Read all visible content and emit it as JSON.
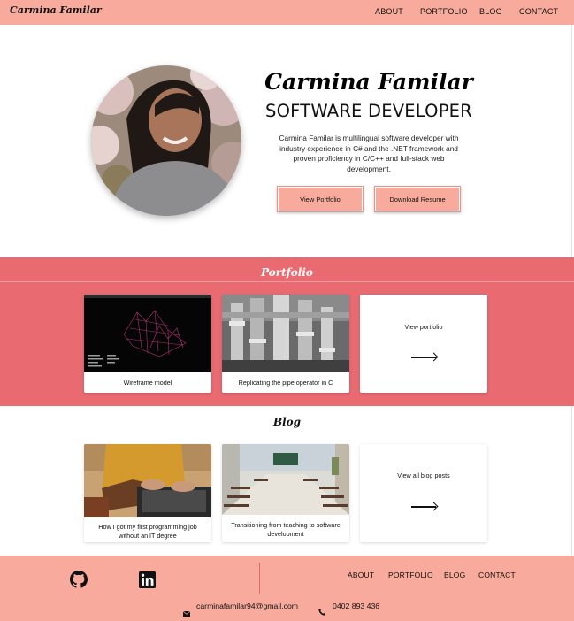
{
  "header": {
    "brand": "Carmina Familar",
    "nav": [
      "ABOUT",
      "PORTFOLIO",
      "BLOG",
      "CONTACT"
    ]
  },
  "hero": {
    "name": "Carmina Familar",
    "title": "SOFTWARE DEVELOPER",
    "description": "Carmina Familar is multilingual software developer with industry experience in C# and the .NET framework and proven proficiency in C/C++ and full-stack web development.",
    "buttons": {
      "portfolio": "View Portfolio",
      "resume": "Download Resume"
    }
  },
  "portfolio": {
    "heading": "Portfolio",
    "items": [
      {
        "caption": "Wireframe model"
      },
      {
        "caption": "Replicating the pipe operator in C"
      }
    ],
    "view_all": "View portfolio"
  },
  "blog": {
    "heading": "Blog",
    "items": [
      {
        "caption": "How I got my first programming job without an IT degree"
      },
      {
        "caption": "Transitioning from teaching to software development"
      }
    ],
    "view_all": "View all blog posts"
  },
  "footer": {
    "nav": [
      "ABOUT",
      "PORTFOLIO",
      "BLOG",
      "CONTACT"
    ],
    "email": "carminafamilar94@gmail.com",
    "phone": "0402 893 436",
    "icons": [
      "github-icon",
      "linkedin-icon",
      "email-icon",
      "phone-icon"
    ]
  },
  "colors": {
    "header_bg": "#f8ab9c",
    "portfolio_bg": "#e96a71",
    "button_bg": "#f8ab9c",
    "footer_bg": "#f8ab9c"
  }
}
